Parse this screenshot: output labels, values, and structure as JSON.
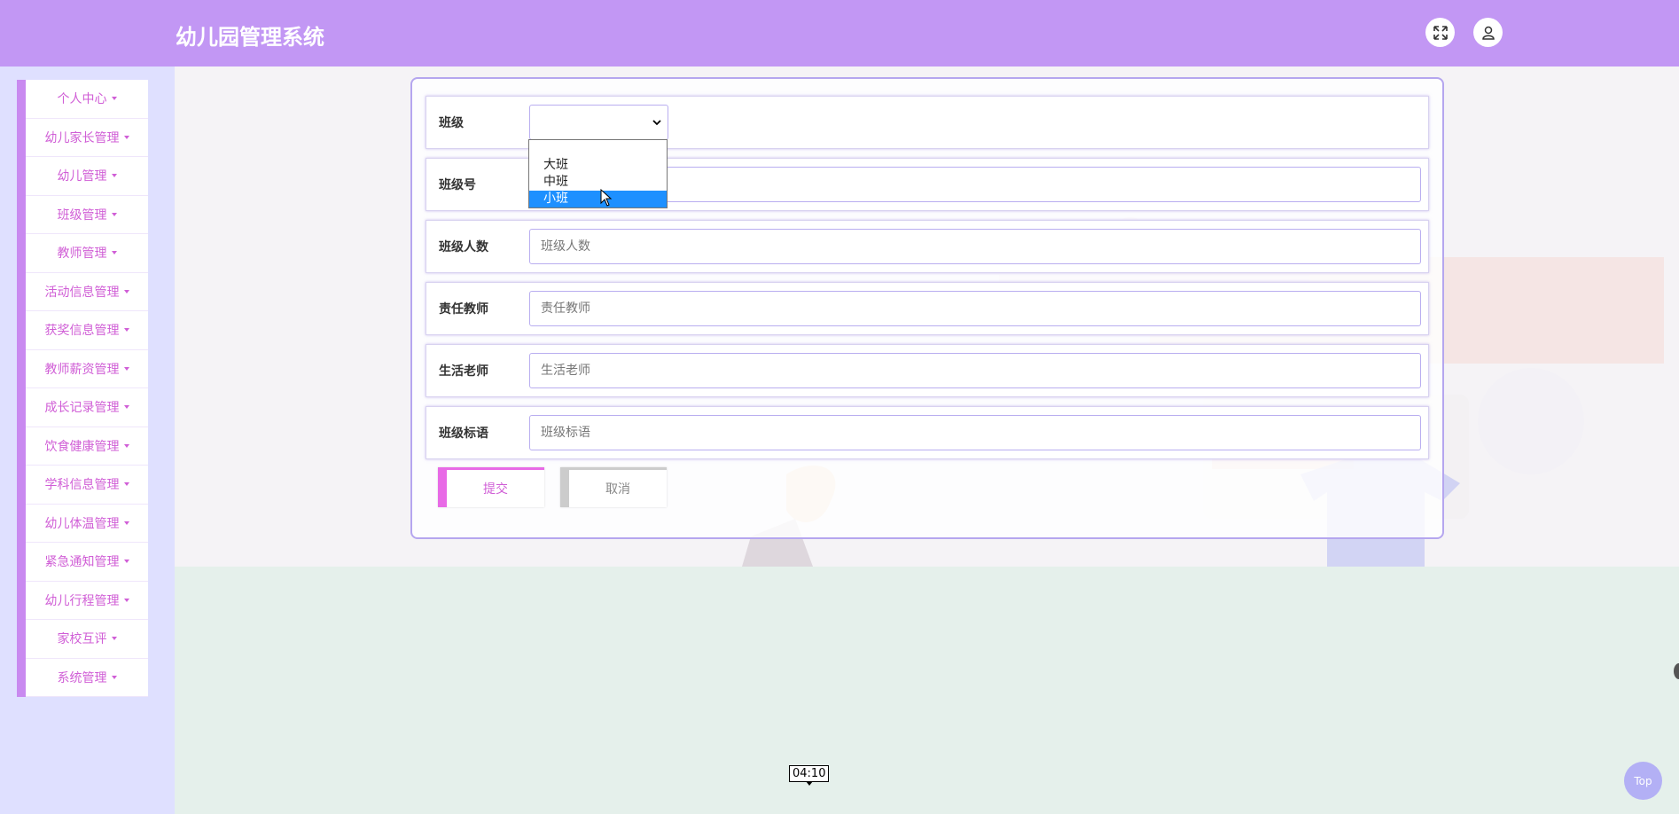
{
  "header": {
    "title": "幼儿园管理系统",
    "fullscreen_icon": "fullscreen-icon",
    "user_icon": "user-icon"
  },
  "sidebar": {
    "items": [
      {
        "label": "个人中心"
      },
      {
        "label": "幼儿家长管理"
      },
      {
        "label": "幼儿管理"
      },
      {
        "label": "班级管理"
      },
      {
        "label": "教师管理"
      },
      {
        "label": "活动信息管理"
      },
      {
        "label": "获奖信息管理"
      },
      {
        "label": "教师薪资管理"
      },
      {
        "label": "成长记录管理"
      },
      {
        "label": "饮食健康管理"
      },
      {
        "label": "学科信息管理"
      },
      {
        "label": "幼儿体温管理"
      },
      {
        "label": "紧急通知管理"
      },
      {
        "label": "幼儿行程管理"
      },
      {
        "label": "家校互评"
      },
      {
        "label": "系统管理"
      }
    ]
  },
  "form": {
    "class_level": {
      "label": "班级",
      "value": "",
      "options": [
        "",
        "大班",
        "中班",
        "小班"
      ],
      "highlighted": "小班"
    },
    "class_no": {
      "label": "班级号",
      "value": "",
      "placeholder": ""
    },
    "class_size": {
      "label": "班级人数",
      "value": "",
      "placeholder": "班级人数"
    },
    "head_teacher": {
      "label": "责任教师",
      "value": "",
      "placeholder": "责任教师"
    },
    "life_teacher": {
      "label": "生活老师",
      "value": "",
      "placeholder": "生活老师"
    },
    "class_slogan": {
      "label": "班级标语",
      "value": "",
      "placeholder": "班级标语"
    },
    "submit_label": "提交",
    "cancel_label": "取消"
  },
  "video_time": "04:10",
  "top_button_label": "Top",
  "colors": {
    "header_bg": "#c297f4",
    "sidebar_accent": "#c98af0",
    "sidebar_text": "#d05ed6",
    "highlight_option": "#1e90ff"
  }
}
